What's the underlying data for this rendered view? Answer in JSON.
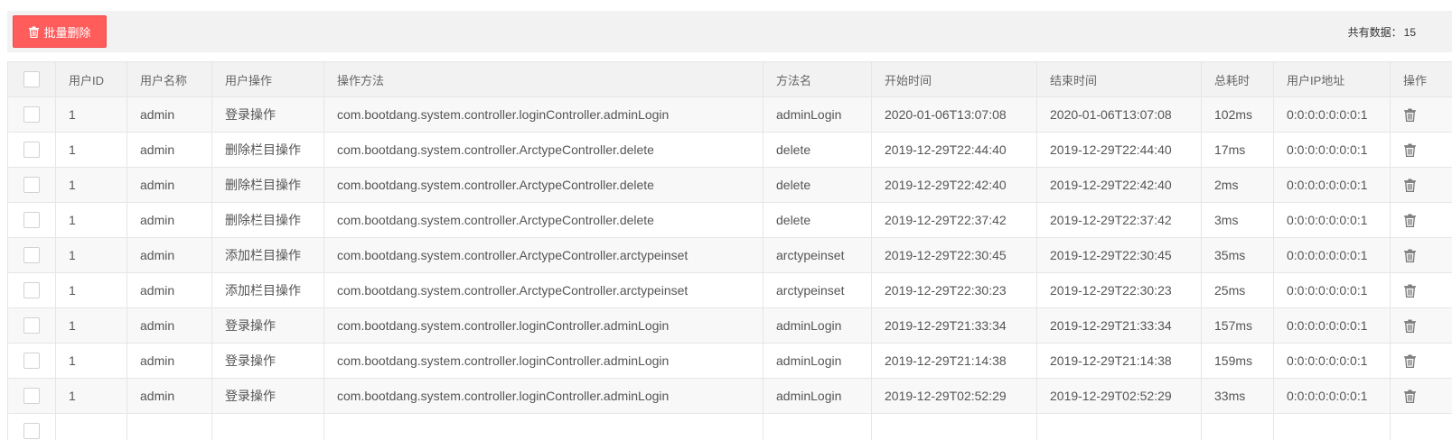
{
  "toolbar": {
    "batch_delete_label": "批量删除",
    "total_label": "共有数据：",
    "total_value": "15"
  },
  "table": {
    "columns": [
      "",
      "用户ID",
      "用户名称",
      "用户操作",
      "操作方法",
      "方法名",
      "开始时间",
      "结束时间",
      "总耗时",
      "用户IP地址",
      "操作"
    ],
    "rows": [
      {
        "user_id": "1",
        "username": "admin",
        "operation": "登录操作",
        "method": "com.bootdang.system.controller.loginController.adminLogin",
        "method_name": "adminLogin",
        "start_time": "2020-01-06T13:07:08",
        "end_time": "2020-01-06T13:07:08",
        "duration": "102ms",
        "ip": "0:0:0:0:0:0:0:1"
      },
      {
        "user_id": "1",
        "username": "admin",
        "operation": "删除栏目操作",
        "method": "com.bootdang.system.controller.ArctypeController.delete",
        "method_name": "delete",
        "start_time": "2019-12-29T22:44:40",
        "end_time": "2019-12-29T22:44:40",
        "duration": "17ms",
        "ip": "0:0:0:0:0:0:0:1"
      },
      {
        "user_id": "1",
        "username": "admin",
        "operation": "删除栏目操作",
        "method": "com.bootdang.system.controller.ArctypeController.delete",
        "method_name": "delete",
        "start_time": "2019-12-29T22:42:40",
        "end_time": "2019-12-29T22:42:40",
        "duration": "2ms",
        "ip": "0:0:0:0:0:0:0:1"
      },
      {
        "user_id": "1",
        "username": "admin",
        "operation": "删除栏目操作",
        "method": "com.bootdang.system.controller.ArctypeController.delete",
        "method_name": "delete",
        "start_time": "2019-12-29T22:37:42",
        "end_time": "2019-12-29T22:37:42",
        "duration": "3ms",
        "ip": "0:0:0:0:0:0:0:1"
      },
      {
        "user_id": "1",
        "username": "admin",
        "operation": "添加栏目操作",
        "method": "com.bootdang.system.controller.ArctypeController.arctypeinset",
        "method_name": "arctypeinset",
        "start_time": "2019-12-29T22:30:45",
        "end_time": "2019-12-29T22:30:45",
        "duration": "35ms",
        "ip": "0:0:0:0:0:0:0:1"
      },
      {
        "user_id": "1",
        "username": "admin",
        "operation": "添加栏目操作",
        "method": "com.bootdang.system.controller.ArctypeController.arctypeinset",
        "method_name": "arctypeinset",
        "start_time": "2019-12-29T22:30:23",
        "end_time": "2019-12-29T22:30:23",
        "duration": "25ms",
        "ip": "0:0:0:0:0:0:0:1"
      },
      {
        "user_id": "1",
        "username": "admin",
        "operation": "登录操作",
        "method": "com.bootdang.system.controller.loginController.adminLogin",
        "method_name": "adminLogin",
        "start_time": "2019-12-29T21:33:34",
        "end_time": "2019-12-29T21:33:34",
        "duration": "157ms",
        "ip": "0:0:0:0:0:0:0:1"
      },
      {
        "user_id": "1",
        "username": "admin",
        "operation": "登录操作",
        "method": "com.bootdang.system.controller.loginController.adminLogin",
        "method_name": "adminLogin",
        "start_time": "2019-12-29T21:14:38",
        "end_time": "2019-12-29T21:14:38",
        "duration": "159ms",
        "ip": "0:0:0:0:0:0:0:1"
      },
      {
        "user_id": "1",
        "username": "admin",
        "operation": "登录操作",
        "method": "com.bootdang.system.controller.loginController.adminLogin",
        "method_name": "adminLogin",
        "start_time": "2019-12-29T02:52:29",
        "end_time": "2019-12-29T02:52:29",
        "duration": "33ms",
        "ip": "0:0:0:0:0:0:0:1"
      },
      {
        "user_id": "",
        "username": "",
        "operation": "",
        "method": "",
        "method_name": "",
        "start_time": "",
        "end_time": "",
        "duration": "",
        "ip": ""
      }
    ]
  },
  "icons": {
    "batch_delete": "trash-icon",
    "row_delete": "trash-icon"
  },
  "colors": {
    "danger_button": "#ff5c5c",
    "header_bg": "#f2f2f2",
    "border": "#e6e6e6"
  }
}
